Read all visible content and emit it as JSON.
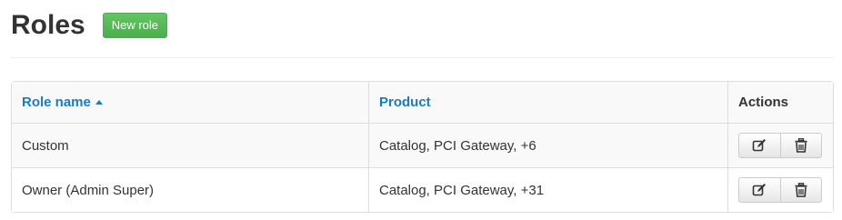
{
  "header": {
    "title": "Roles",
    "new_role_label": "New role"
  },
  "table": {
    "columns": {
      "role_name": "Role name",
      "product": "Product",
      "actions": "Actions"
    },
    "sort": {
      "column": "role_name",
      "direction": "ascending"
    },
    "rows": [
      {
        "role_name": "Custom",
        "product": "Catalog, PCI Gateway, +6",
        "actions": [
          "edit-icon",
          "trash-icon"
        ]
      },
      {
        "role_name": "Owner (Admin Super)",
        "product": "Catalog, PCI Gateway, +31",
        "actions": [
          "edit-icon",
          "trash-icon"
        ]
      }
    ]
  },
  "colors": {
    "link": "#1a7cc0",
    "success_button": "#5cb85c",
    "border": "#dddddd",
    "stripe": "#f9f9f9"
  }
}
